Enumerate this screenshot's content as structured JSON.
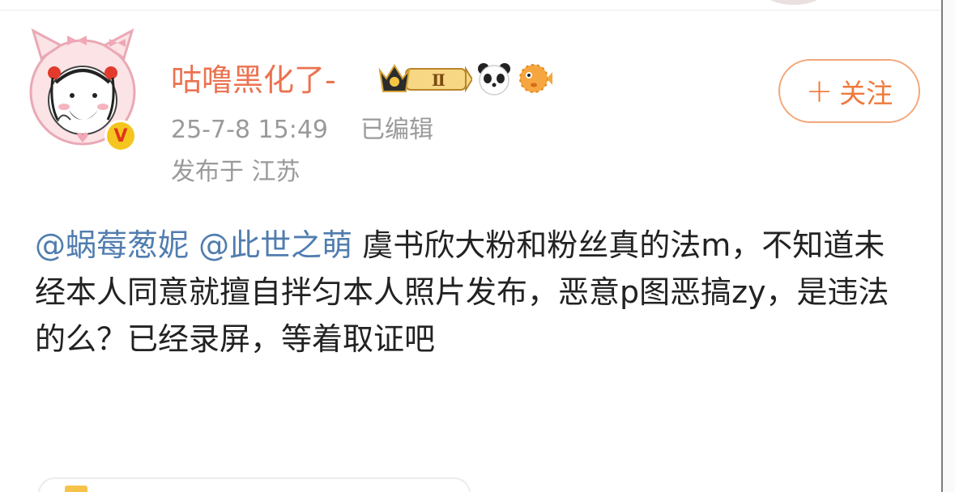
{
  "post": {
    "author": {
      "name": "咕噜黑化了-",
      "verified": true,
      "badges": [
        "vip-level-crown-badge",
        "panda-emoji-badge",
        "pufferfish-emoji-badge"
      ],
      "vip_level": "Ⅱ"
    },
    "timestamp": "25-7-8 15:49",
    "edited_label": "已编辑",
    "location": "发布于 江苏",
    "follow_label": "关注",
    "mentions": [
      "@蜗莓葱妮",
      "@此世之萌"
    ],
    "body": " 虞书欣大粉和粉丝真的法m，不知道未经本人同意就擅自拌匀本人照片发布，恶意p图恶搞zy，是违法的么？已经录屏，等着取证吧"
  },
  "colors": {
    "username": "#eb7350",
    "mention": "#507daf",
    "meta": "#9a9a9a",
    "follow": "#ef7a3b"
  }
}
